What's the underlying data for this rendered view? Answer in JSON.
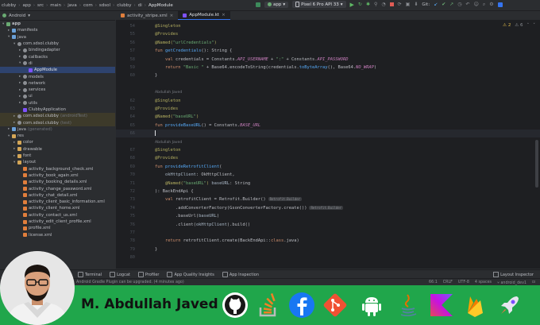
{
  "breadcrumbs": [
    "clubby",
    "app",
    "src",
    "main",
    "java",
    "com",
    "sdsol",
    "clubby",
    "di",
    "AppModule"
  ],
  "toolbar": {
    "run_config": "app",
    "device": "Pixel 6 Pro API 33",
    "vcs_label": "Git:"
  },
  "project_panel": {
    "view_label": "Android"
  },
  "tree": [
    {
      "label": "app",
      "indent": 0,
      "arrow": "▾",
      "icon": "module-icon",
      "color": "#6aab73",
      "bold": true
    },
    {
      "label": "manifests",
      "indent": 1,
      "arrow": "▸",
      "icon": "folder-icon",
      "color": "#6aa0d8"
    },
    {
      "label": "java",
      "indent": 1,
      "arrow": "▾",
      "icon": "folder-icon",
      "color": "#6aa0d8"
    },
    {
      "label": "com.sdsol.clubby",
      "indent": 2,
      "arrow": "▾",
      "icon": "package-icon",
      "color": "#8c8f94"
    },
    {
      "label": "bindingadapter",
      "indent": 3,
      "arrow": "▸",
      "icon": "package-icon",
      "color": "#8c8f94"
    },
    {
      "label": "callbacks",
      "indent": 3,
      "arrow": "▸",
      "icon": "package-icon",
      "color": "#8c8f94"
    },
    {
      "label": "di",
      "indent": 3,
      "arrow": "▾",
      "icon": "package-icon",
      "color": "#8c8f94"
    },
    {
      "label": "AppModule",
      "indent": 4,
      "arrow": "",
      "icon": "kotlin-file-icon",
      "color": "#7f52ff",
      "selected": true
    },
    {
      "label": "models",
      "indent": 3,
      "arrow": "▸",
      "icon": "package-icon",
      "color": "#8c8f94"
    },
    {
      "label": "network",
      "indent": 3,
      "arrow": "▸",
      "icon": "package-icon",
      "color": "#8c8f94"
    },
    {
      "label": "services",
      "indent": 3,
      "arrow": "▸",
      "icon": "package-icon",
      "color": "#8c8f94"
    },
    {
      "label": "ui",
      "indent": 3,
      "arrow": "▸",
      "icon": "package-icon",
      "color": "#8c8f94"
    },
    {
      "label": "utils",
      "indent": 3,
      "arrow": "▸",
      "icon": "package-icon",
      "color": "#8c8f94"
    },
    {
      "label": "ClubbyApplication",
      "indent": 3,
      "arrow": "",
      "icon": "kotlin-file-icon",
      "color": "#7f52ff"
    },
    {
      "label": "com.sdsol.clubby",
      "indent": 2,
      "arrow": "▸",
      "icon": "package-icon",
      "color": "#8c8f94",
      "hint": "(androidTest)",
      "excluded": true
    },
    {
      "label": "com.sdsol.clubby",
      "indent": 2,
      "arrow": "▸",
      "icon": "package-icon",
      "color": "#8c8f94",
      "hint": "(test)",
      "excluded": true
    },
    {
      "label": "java",
      "indent": 1,
      "arrow": "▸",
      "icon": "folder-icon",
      "color": "#6aa0d8",
      "hint": "(generated)"
    },
    {
      "label": "res",
      "indent": 1,
      "arrow": "▾",
      "icon": "folder-icon",
      "color": "#d4a657"
    },
    {
      "label": "color",
      "indent": 2,
      "arrow": "▸",
      "icon": "folder-icon",
      "color": "#d4a657"
    },
    {
      "label": "drawable",
      "indent": 2,
      "arrow": "▸",
      "icon": "folder-icon",
      "color": "#d4a657"
    },
    {
      "label": "font",
      "indent": 2,
      "arrow": "▸",
      "icon": "folder-icon",
      "color": "#d4a657"
    },
    {
      "label": "layout",
      "indent": 2,
      "arrow": "▾",
      "icon": "folder-icon",
      "color": "#d4a657"
    },
    {
      "label": "activity_background_check.xml",
      "indent": 3,
      "arrow": "",
      "icon": "xml-file-icon",
      "color": "#e07e3c"
    },
    {
      "label": "activity_book_again.xml",
      "indent": 3,
      "arrow": "",
      "icon": "xml-file-icon",
      "color": "#e07e3c"
    },
    {
      "label": "activity_booking_details.xml",
      "indent": 3,
      "arrow": "",
      "icon": "xml-file-icon",
      "color": "#e07e3c"
    },
    {
      "label": "activity_change_password.xml",
      "indent": 3,
      "arrow": "",
      "icon": "xml-file-icon",
      "color": "#e07e3c"
    },
    {
      "label": "activity_chat_detail.xml",
      "indent": 3,
      "arrow": "",
      "icon": "xml-file-icon",
      "color": "#e07e3c"
    },
    {
      "label": "activity_client_basic_information.xml",
      "indent": 3,
      "arrow": "",
      "icon": "xml-file-icon",
      "color": "#e07e3c"
    },
    {
      "label": "activity_client_home.xml",
      "indent": 3,
      "arrow": "",
      "icon": "xml-file-icon",
      "color": "#e07e3c"
    },
    {
      "label": "activity_contact_us.xml",
      "indent": 3,
      "arrow": "",
      "icon": "xml-file-icon",
      "color": "#e07e3c"
    },
    {
      "label": "activity_edit_client_profile.xml",
      "indent": 3,
      "arrow": "",
      "icon": "xml-file-icon",
      "color": "#e07e3c"
    },
    {
      "label": "profile.xml",
      "indent": 3,
      "arrow": "",
      "icon": "xml-file-icon",
      "color": "#e07e3c"
    },
    {
      "label": "license.xml",
      "indent": 3,
      "arrow": "",
      "icon": "xml-file-icon",
      "color": "#e07e3c"
    }
  ],
  "tabs": [
    {
      "label": "activity_stripe.xml",
      "icon": "xml-file-icon",
      "color": "#e07e3c",
      "active": false
    },
    {
      "label": "AppModule.kt",
      "icon": "kotlin-file-icon",
      "color": "#7f52ff",
      "active": true
    }
  ],
  "editor": {
    "warnings": {
      "warn_count": "2",
      "weak_count": "6"
    },
    "lines": [
      {
        "n": "54",
        "author": "",
        "html": "<span class='ann'>@Singleton</span>"
      },
      {
        "n": "55",
        "author": "",
        "html": "<span class='ann'>@Provides</span>"
      },
      {
        "n": "56",
        "author": "",
        "html": "<span class='ann'>@Named(</span><span class='str'>\"urlCredentials\"</span><span class='ann'>)</span>"
      },
      {
        "n": "57",
        "author": "",
        "html": "<span class='kw'>fun </span><span class='fn'>getCredentials</span>(): String {"
      },
      {
        "n": "58",
        "author": "",
        "html": "    <span class='kw'>val </span>credentials = Constants.<span class='cst'>API_USERNAME</span> + <span class='str'>\":\"</span> + Constants.<span class='cst'>API_PASSWORD</span>"
      },
      {
        "n": "59",
        "author": "",
        "html": "    <span class='kw'>return </span><span class='str'>\"Basic \"</span> + Base64.encodeToString(credentials.<span class='fn'>toByteArray</span>(), Base64.<span class='cst'>NO_WRAP</span>)"
      },
      {
        "n": "60",
        "author": "",
        "html": "}"
      },
      {
        "n": "",
        "author": "",
        "html": ""
      },
      {
        "n": "",
        "author": "Abdullah Javed",
        "html": ""
      },
      {
        "n": "62",
        "author": "",
        "html": "<span class='ann'>@Singleton</span>"
      },
      {
        "n": "63",
        "author": "",
        "html": "<span class='ann'>@Provides</span>"
      },
      {
        "n": "64",
        "author": "",
        "html": "<span class='ann'>@Named(</span><span class='str'>\"baseURL\"</span><span class='ann'>)</span>"
      },
      {
        "n": "65",
        "author": "",
        "html": "<span class='kw'>fun </span><span class='fn'>provideBaseURL</span>() = Constants.<span class='cst'>BASE_URL</span>"
      },
      {
        "n": "66",
        "author": "",
        "html": "",
        "current": true
      },
      {
        "n": "",
        "author": "Abdullah Javed",
        "html": ""
      },
      {
        "n": "67",
        "author": "",
        "html": "<span class='ann'>@Singleton</span>"
      },
      {
        "n": "68",
        "author": "",
        "html": "<span class='ann'>@Provides</span>"
      },
      {
        "n": "69",
        "author": "",
        "html": "<span class='kw'>fun </span><span class='fn'>provideRetrofitClient</span>("
      },
      {
        "n": "70",
        "author": "",
        "html": "    <span class='par'>okHttpClient</span>: OkHttpClient,"
      },
      {
        "n": "71",
        "author": "",
        "html": "    <span class='ann'>@Named(</span><span class='str'>\"baseURL\"</span><span class='ann'>) </span><span class='par'>baseURL</span>: String"
      },
      {
        "n": "72",
        "author": "",
        "html": "): BackEndApi {"
      },
      {
        "n": "73",
        "author": "",
        "html": "    <span class='kw'>val </span>retrofitClient = Retrofit.Builder()<span class='inlay'>Retrofit.Builder</span>"
      },
      {
        "n": "74",
        "author": "",
        "html": "        .addConverterFactory(GsonConverterFactory.create())<span class='inlay'>Retrofit.Builder</span>"
      },
      {
        "n": "75",
        "author": "",
        "html": "        .baseUrl(<span class='par'>baseURL</span>)"
      },
      {
        "n": "76",
        "author": "",
        "html": "        .client(<span class='par'>okHttpClient</span>).build()"
      },
      {
        "n": "77",
        "author": "",
        "html": ""
      },
      {
        "n": "78",
        "author": "",
        "html": "    <span class='kw'>return </span>retrofitClient.create(BackEndApi::<span class='kw'>class</span>.java)"
      },
      {
        "n": "79",
        "author": "",
        "html": "}"
      },
      {
        "n": "80",
        "author": "",
        "html": ""
      }
    ]
  },
  "tool_windows": [
    "Terminal",
    "Logcat",
    "Profiler",
    "App Quality Insights",
    "App Inspection"
  ],
  "layout_inspector_label": "Layout Inspector",
  "status": {
    "message": "Android Gradle Plugin can be upgraded. (4 minutes ago)",
    "position": "66:1",
    "line_sep": "CRLF",
    "encoding": "UTF-8",
    "indent": "4 spaces",
    "branch": "android_dev1"
  },
  "banner": {
    "name": "M. Abdullah Javed",
    "background": "#20a64b",
    "logos": [
      "github-icon",
      "stackoverflow-icon",
      "facebook-icon",
      "git-icon",
      "android-icon",
      "java-icon",
      "kotlin-icon",
      "firebase-icon",
      "rocket-icon"
    ]
  }
}
